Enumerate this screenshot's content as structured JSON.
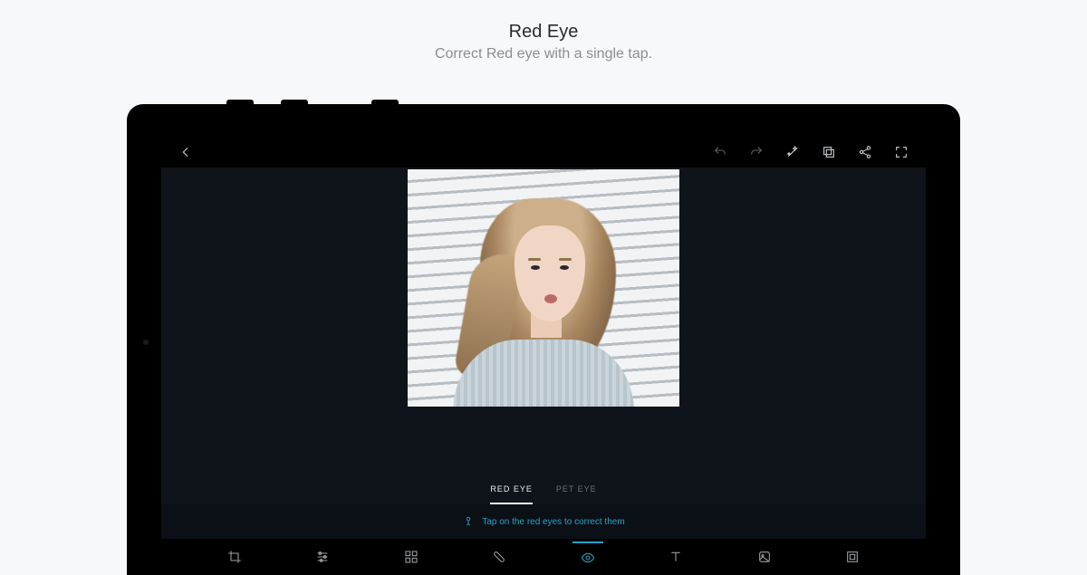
{
  "promo": {
    "title": "Red Eye",
    "subtitle": "Correct Red eye with a single tap."
  },
  "topbar": {
    "back": "back-icon",
    "undo": "undo-icon",
    "redo": "redo-icon",
    "auto": "magic-wand-icon",
    "collage": "layers-icon",
    "share": "share-icon",
    "fullscreen": "fullscreen-icon"
  },
  "subtabs": {
    "items": [
      {
        "label": "RED EYE",
        "active": true
      },
      {
        "label": "PET EYE",
        "active": false
      }
    ]
  },
  "hint": {
    "icon": "tap-icon",
    "text": "Tap on the red eyes to correct them"
  },
  "bottomnav": {
    "items": [
      {
        "name": "crop",
        "icon": "crop-icon"
      },
      {
        "name": "adjust",
        "icon": "sliders-icon"
      },
      {
        "name": "looks",
        "icon": "grid-icon"
      },
      {
        "name": "heal",
        "icon": "bandaid-icon"
      },
      {
        "name": "eye",
        "icon": "eye-icon",
        "active": true
      },
      {
        "name": "text",
        "icon": "text-icon"
      },
      {
        "name": "sticker",
        "icon": "sticker-icon"
      },
      {
        "name": "frame",
        "icon": "frame-icon"
      }
    ]
  },
  "colors": {
    "accent": "#2aa3c7"
  }
}
